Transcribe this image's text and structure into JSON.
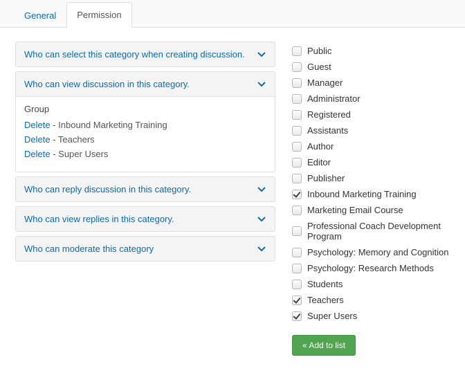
{
  "tabs": [
    {
      "label": "General",
      "active": false
    },
    {
      "label": "Permission",
      "active": true
    }
  ],
  "accordions": [
    {
      "label": "Who can select this category when creating discussion.",
      "expanded": false
    },
    {
      "label": "Who can view discussion in this category.",
      "expanded": true,
      "group_label": "Group",
      "delete_label": "Delete",
      "groups": [
        "Inbound Marketing Training",
        "Teachers",
        "Super Users"
      ]
    },
    {
      "label": "Who can reply discussion in this category.",
      "expanded": false
    },
    {
      "label": "Who can view replies in this category.",
      "expanded": false
    },
    {
      "label": "Who can moderate this category",
      "expanded": false
    }
  ],
  "checklist": [
    {
      "label": "Public",
      "checked": false
    },
    {
      "label": "Guest",
      "checked": false
    },
    {
      "label": "Manager",
      "checked": false
    },
    {
      "label": "Administrator",
      "checked": false
    },
    {
      "label": "Registered",
      "checked": false
    },
    {
      "label": "Assistants",
      "checked": false
    },
    {
      "label": "Author",
      "checked": false
    },
    {
      "label": "Editor",
      "checked": false
    },
    {
      "label": "Publisher",
      "checked": false
    },
    {
      "label": "Inbound Marketing Training",
      "checked": true
    },
    {
      "label": "Marketing Email Course",
      "checked": false
    },
    {
      "label": "Professional Coach Development Program",
      "checked": false
    },
    {
      "label": "Psychology: Memory and Cognition",
      "checked": false
    },
    {
      "label": "Psychology: Research Methods",
      "checked": false
    },
    {
      "label": "Students",
      "checked": false
    },
    {
      "label": "Teachers",
      "checked": true
    },
    {
      "label": "Super Users",
      "checked": true
    }
  ],
  "add_button_label": "« Add to list"
}
